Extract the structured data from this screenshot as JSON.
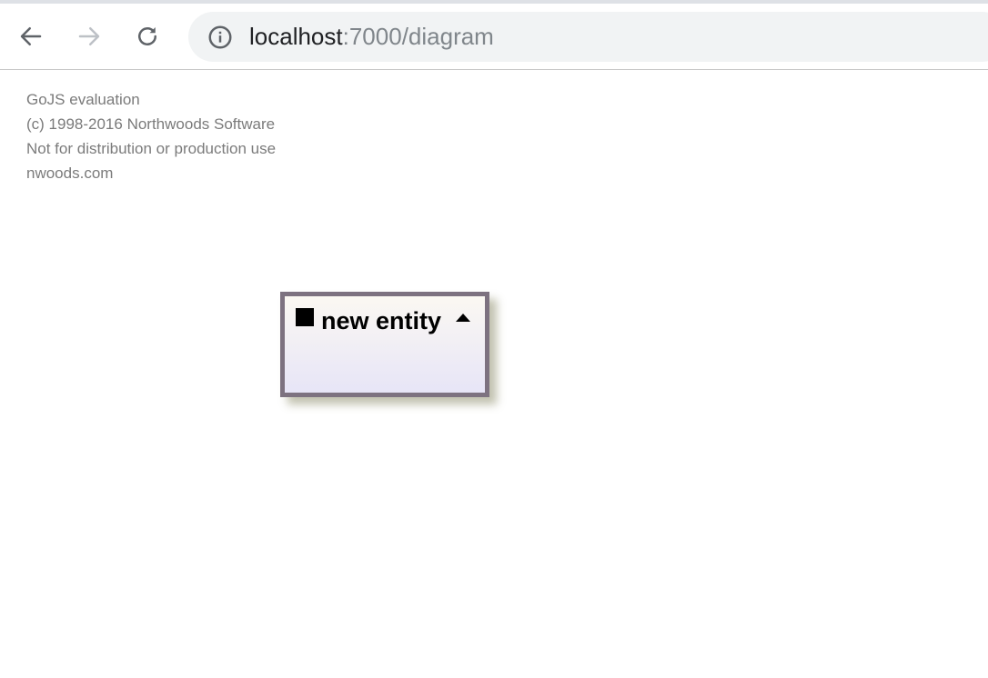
{
  "browser": {
    "url_host": "localhost",
    "url_path": ":7000/diagram",
    "icons": {
      "back": "arrow-left-icon",
      "forward": "arrow-right-icon",
      "reload": "reload-icon",
      "site_info": "info-icon"
    }
  },
  "watermark": {
    "lines": [
      "GoJS evaluation",
      "(c) 1998-2016 Northwoods Software",
      "Not for distribution or production use",
      "nwoods.com"
    ]
  },
  "diagram": {
    "node": {
      "title": "new entity",
      "expander": "collapse-arrow-up-icon"
    }
  },
  "colors": {
    "node_border": "#7d7280",
    "node_fill_top": "#fbf8f2",
    "node_fill_bottom": "#e7e5f7",
    "watermark_text": "#7b7b7b"
  }
}
